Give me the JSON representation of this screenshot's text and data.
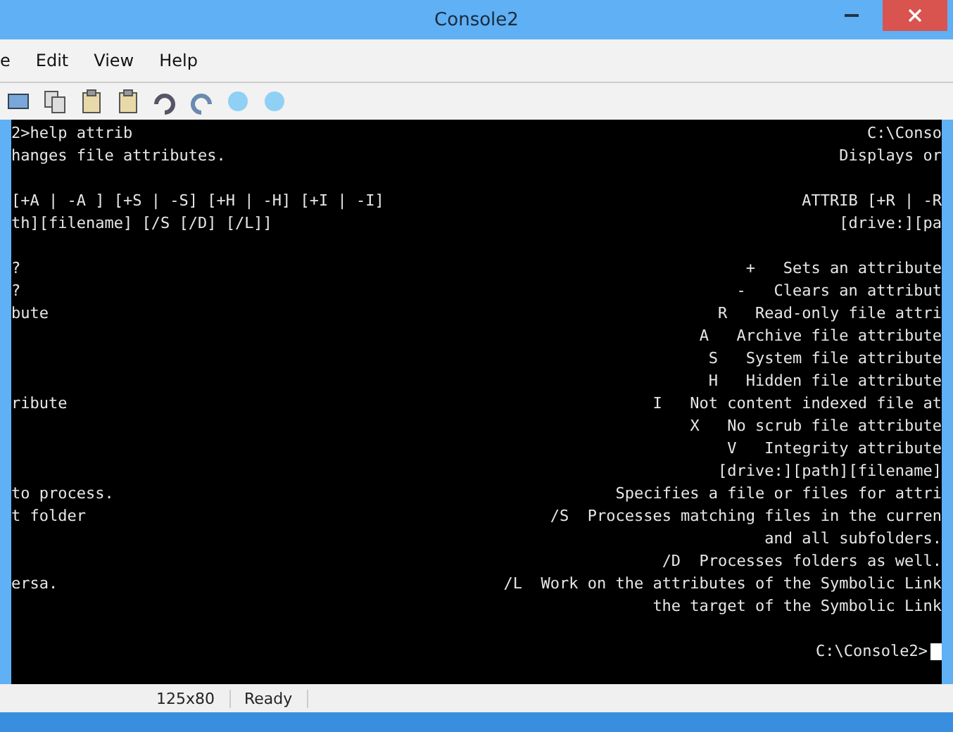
{
  "window": {
    "title": "Console2"
  },
  "menu": [
    {
      "label": "e"
    },
    {
      "label": "Edit"
    },
    {
      "label": "View"
    },
    {
      "label": "Help"
    }
  ],
  "toolbar": {
    "buttons": [
      {
        "kind": "window"
      },
      {
        "kind": "copy"
      },
      {
        "kind": "paste"
      },
      {
        "kind": "paste"
      },
      {
        "kind": "undo"
      },
      {
        "kind": "redo"
      },
      {
        "kind": "info"
      },
      {
        "kind": "info"
      }
    ]
  },
  "console": {
    "lines": [
      {
        "left": "2>help attrib",
        "right": "C:\\Conso"
      },
      {
        "left": "hanges file attributes.",
        "right": "Displays or"
      },
      {
        "gap_before": true,
        "left": "[+A | -A ] [+S | -S] [+H | -H] [+I | -I]",
        "right": "ATTRIB [+R | -R"
      },
      {
        "left": "th][filename] [/S [/D] [/L]]",
        "right": "[drive:][pa"
      },
      {
        "gap_before": true,
        "left": "?",
        "right": "+   Sets an attribute"
      },
      {
        "left": "?",
        "right": "-   Clears an attribut"
      },
      {
        "left": "bute",
        "right": "R   Read-only file attri"
      },
      {
        "right": "A   Archive file attribute"
      },
      {
        "right": "S   System file attribute"
      },
      {
        "right": "H   Hidden file attribute"
      },
      {
        "left": "ribute",
        "right": "I   Not content indexed file at"
      },
      {
        "right": "X   No scrub file attribute"
      },
      {
        "right": "V   Integrity attribute"
      },
      {
        "right": "[drive:][path][filename]"
      },
      {
        "left": "to process.",
        "right": "Specifies a file or files for attri"
      },
      {
        "left": "t folder",
        "right": "/S  Processes matching files in the curren"
      },
      {
        "right": "and all subfolders."
      },
      {
        "right": "/D  Processes folders as well."
      },
      {
        "left": "ersa.",
        "right": "/L  Work on the attributes of the Symbolic Link"
      },
      {
        "right": "the target of the Symbolic Link"
      },
      {
        "gap_before": true,
        "right": "C:\\Console2>",
        "cursor": true
      }
    ]
  },
  "status_bar": {
    "size": "125x80",
    "state": "Ready"
  }
}
